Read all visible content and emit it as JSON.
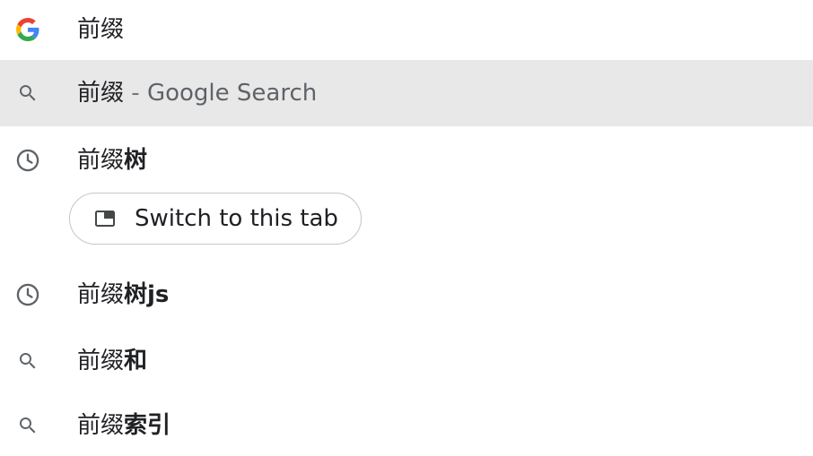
{
  "omnibox": {
    "input_text": "前缀",
    "input_icon": "google-g-icon"
  },
  "suggestions": [
    {
      "type": "search",
      "icon": "search-icon",
      "prefix": "前缀",
      "separator": " - ",
      "suffix": "Google Search",
      "selected": true
    },
    {
      "type": "history",
      "icon": "history-clock-icon",
      "prefix": "前缀",
      "suffix": "树",
      "action": {
        "label": "Switch to this tab",
        "icon": "switch-tab-icon"
      }
    },
    {
      "type": "history",
      "icon": "history-clock-icon",
      "prefix": "前缀",
      "suffix": "树js"
    },
    {
      "type": "search",
      "icon": "search-icon",
      "prefix": "前缀",
      "suffix": "和"
    },
    {
      "type": "search",
      "icon": "search-icon",
      "prefix": "前缀",
      "suffix": "索引"
    }
  ],
  "colors": {
    "selected_row_bg": "#e8e8e8",
    "icon_gray": "#5f6368",
    "text": "#202124",
    "google_blue": "#4285F4",
    "google_red": "#EA4335",
    "google_yellow": "#FBBC05",
    "google_green": "#34A853"
  }
}
